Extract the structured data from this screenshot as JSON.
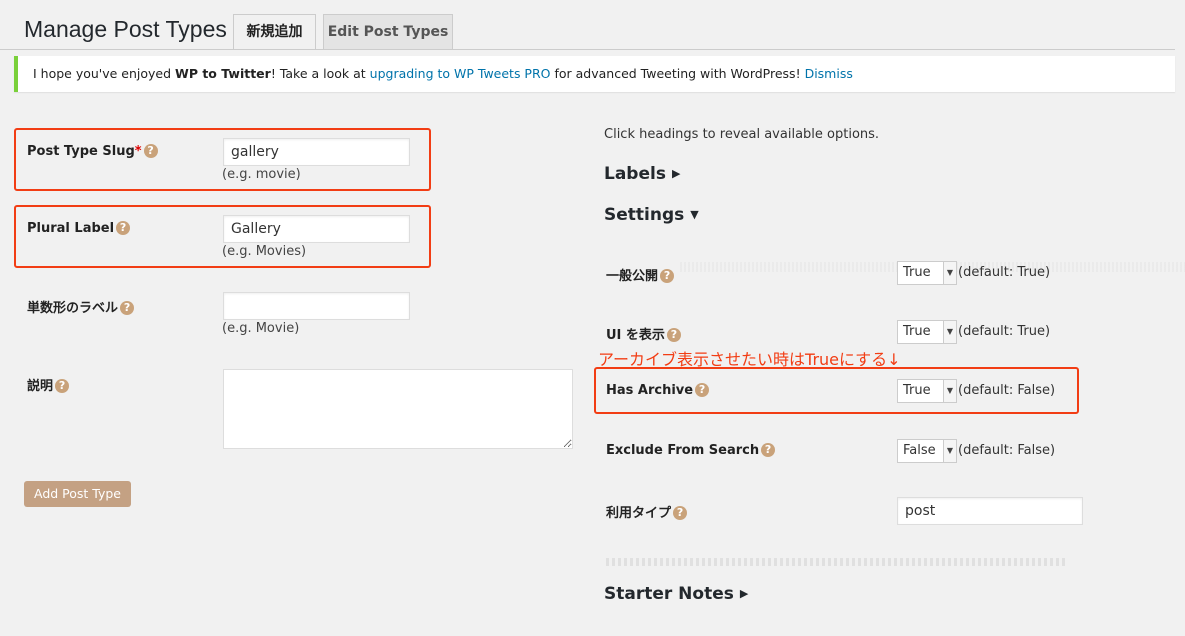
{
  "header": {
    "title": "Manage Post Types",
    "tabs": [
      {
        "label": "新規追加",
        "active": true
      },
      {
        "label": "Edit Post Types",
        "active": false
      }
    ]
  },
  "notice": {
    "text_before": "I hope you've enjoyed ",
    "plugin_name": "WP to Twitter",
    "text_mid": "! Take a look at ",
    "upgrade_link": "upgrading to WP Tweets PRO",
    "text_after": " for advanced Tweeting with WordPress! ",
    "dismiss_link": "Dismiss"
  },
  "form": {
    "slug": {
      "label": "Post Type Slug",
      "required_mark": "*",
      "value": "gallery",
      "hint": "(e.g. movie)"
    },
    "plural": {
      "label": "Plural Label",
      "value": "Gallery",
      "hint": "(e.g. Movies)"
    },
    "singular": {
      "label": "単数形のラベル",
      "value": "",
      "hint": "(e.g. Movie)"
    },
    "description": {
      "label": "説明",
      "value": ""
    },
    "add_button": "Add Post Type"
  },
  "options": {
    "intro": "Click headings to reveal available options.",
    "labels_heading": "Labels",
    "settings_heading": "Settings",
    "starter_notes_heading": "Starter Notes",
    "annotation": "アーカイブ表示させたい時はTrueにする↓",
    "settings": [
      {
        "label": "一般公開",
        "value": "True",
        "default": "(default: True)"
      },
      {
        "label": "UI を表示",
        "value": "True",
        "default": "(default: True)"
      },
      {
        "label": "Has Archive",
        "value": "True",
        "default": "(default: False)"
      },
      {
        "label": "Exclude From Search",
        "value": "False",
        "default": "(default: False)"
      },
      {
        "label": "利用タイプ",
        "value": "post"
      }
    ]
  },
  "colors": {
    "highlight_border": "#f23d14",
    "notice_accent": "#7ad03a",
    "link": "#0073aa",
    "help_icon": "#c9a27a",
    "button": "#c4a183"
  },
  "icons": {
    "help": "question-circle-icon",
    "expand": "triangle-right-icon",
    "collapse": "triangle-down-icon",
    "select_arrow": "caret-down-icon"
  }
}
